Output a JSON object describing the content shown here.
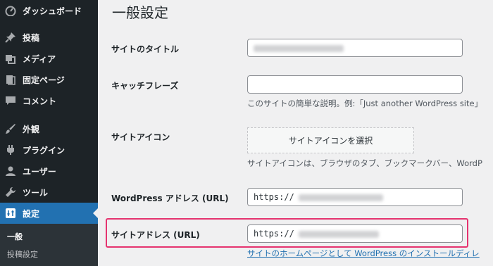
{
  "sidebar": {
    "items": [
      {
        "label": "ダッシュボード",
        "icon": "dashboard-icon"
      },
      {
        "label": "投稿",
        "icon": "pin-icon"
      },
      {
        "label": "メディア",
        "icon": "media-icon"
      },
      {
        "label": "固定ページ",
        "icon": "page-icon"
      },
      {
        "label": "コメント",
        "icon": "comment-icon"
      },
      {
        "label": "外観",
        "icon": "brush-icon"
      },
      {
        "label": "プラグイン",
        "icon": "plugin-icon"
      },
      {
        "label": "ユーザー",
        "icon": "user-icon"
      },
      {
        "label": "ツール",
        "icon": "wrench-icon"
      },
      {
        "label": "設定",
        "icon": "settings-icon",
        "active": true
      }
    ],
    "submenu": [
      {
        "label": "一般",
        "current": true
      },
      {
        "label": "投稿設定"
      }
    ],
    "active_color": "#2271b1"
  },
  "main": {
    "title": "一般設定",
    "fields": {
      "site_title": {
        "label": "サイトのタイトル",
        "value": ""
      },
      "tagline": {
        "label": "キャッチフレーズ",
        "value": "",
        "description": "このサイトの簡単な説明。例:「Just another WordPress site」"
      },
      "site_icon": {
        "label": "サイトアイコン",
        "button": "サイトアイコンを選択",
        "description": "サイトアイコンは、ブラウザのタブ、ブックマークバー、WordP"
      },
      "wp_address": {
        "label": "WordPress アドレス (URL)",
        "value": "https://"
      },
      "site_address": {
        "label": "サイトアドレス (URL)",
        "value": "https://",
        "description_link": "サイトのホームページとして WordPress のインストールディレ"
      }
    },
    "highlight_color": "#e5336f"
  }
}
